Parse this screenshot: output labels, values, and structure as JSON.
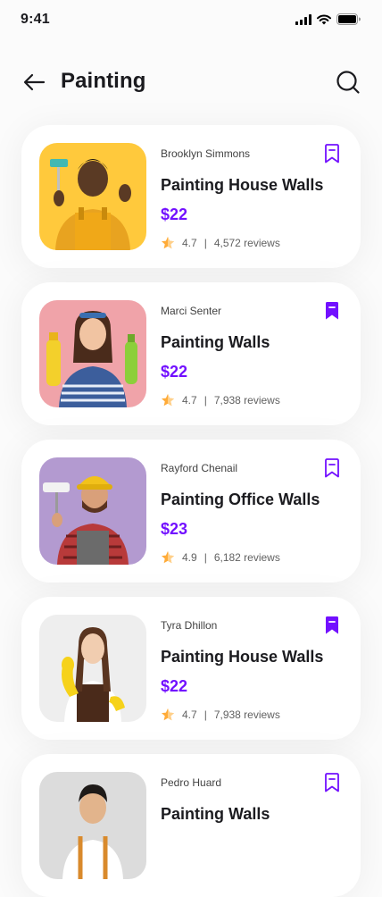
{
  "status_bar": {
    "time": "9:41"
  },
  "header": {
    "title": "Painting"
  },
  "colors": {
    "accent": "#7210ff",
    "star": "#ffab38"
  },
  "services": [
    {
      "provider": "Brooklyn Simmons",
      "title": "Painting House Walls",
      "price": "$22",
      "rating": "4.7",
      "reviews": "4,572 reviews",
      "bookmarked": false
    },
    {
      "provider": "Marci Senter",
      "title": "Painting Walls",
      "price": "$22",
      "rating": "4.7",
      "reviews": "7,938 reviews",
      "bookmarked": true
    },
    {
      "provider": "Rayford Chenail",
      "title": "Painting Office Walls",
      "price": "$23",
      "rating": "4.9",
      "reviews": "6,182 reviews",
      "bookmarked": false
    },
    {
      "provider": "Tyra Dhillon",
      "title": "Painting House Walls",
      "price": "$22",
      "rating": "4.7",
      "reviews": "7,938 reviews",
      "bookmarked": true
    },
    {
      "provider": "Pedro Huard",
      "title": "Painting Walls",
      "bookmarked": false
    }
  ]
}
